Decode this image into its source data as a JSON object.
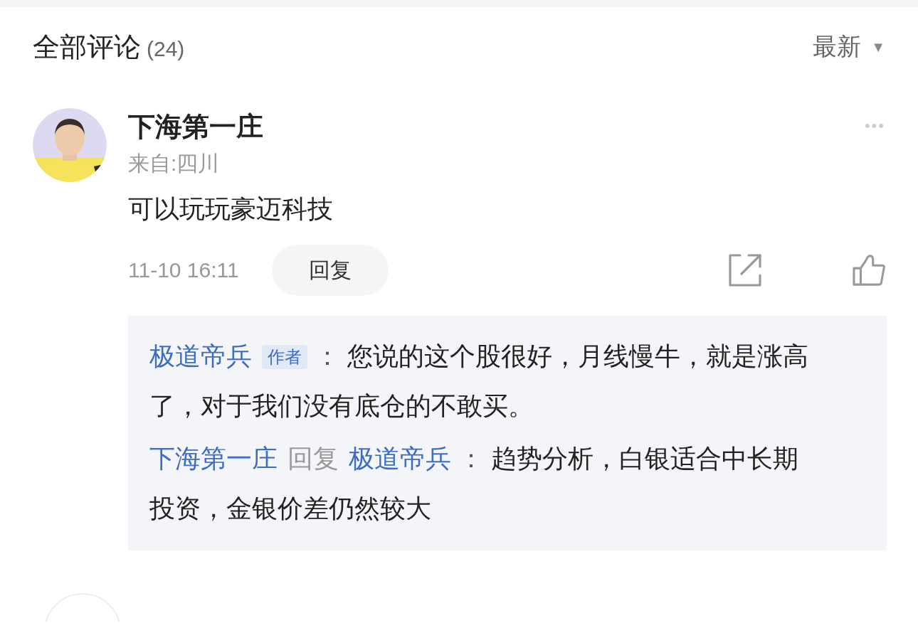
{
  "header": {
    "title": "全部评论",
    "count": "(24)",
    "sort": "最新",
    "sort_caret": "▼"
  },
  "comment": {
    "author": "下海第一庄",
    "location": "来自:四川",
    "text": "可以玩玩豪迈科技",
    "time": "11-10 16:11",
    "reply_button": "回复",
    "more": "•••",
    "replies": [
      {
        "author": "极道帝兵",
        "badge": "作者",
        "colon": "：",
        "text": "您说的这个股很好，月线慢牛，就是涨高了，对于我们没有底仓的不敢买。"
      },
      {
        "author": "下海第一庄",
        "reply_word": "回复",
        "reply_to": "极道帝兵",
        "colon": "：",
        "text": "趋势分析，白银适合中长期投资，金银价差仍然较大"
      }
    ]
  },
  "next_comment": {
    "avatar": {
      "kind": "blank"
    }
  }
}
